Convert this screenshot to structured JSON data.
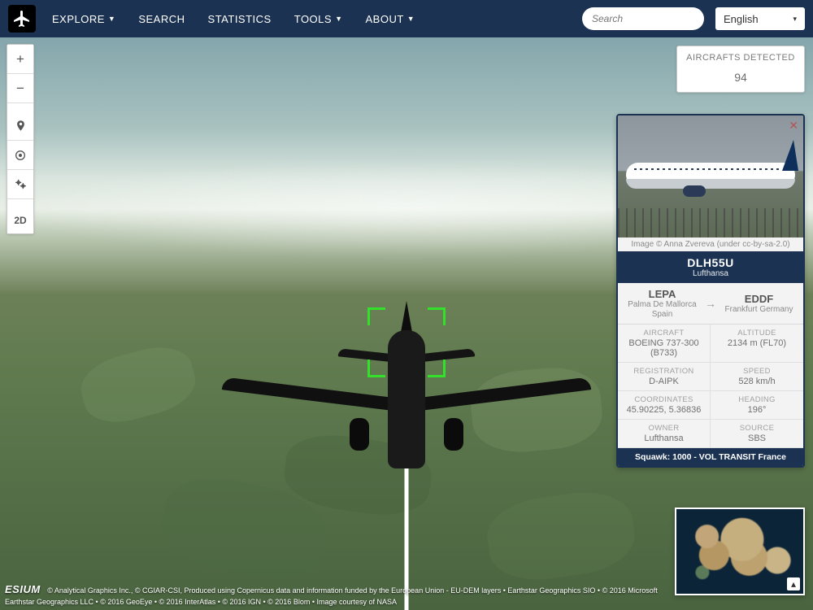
{
  "nav": {
    "items": [
      {
        "label": "EXPLORE",
        "caret": true
      },
      {
        "label": "SEARCH",
        "caret": false
      },
      {
        "label": "STATISTICS",
        "caret": false
      },
      {
        "label": "TOOLS",
        "caret": true
      },
      {
        "label": "ABOUT",
        "caret": true
      }
    ],
    "search_placeholder": "Search",
    "language": "English"
  },
  "toolbar": {
    "zoom_in": "+",
    "zoom_out": "−",
    "mode_label": "2D"
  },
  "detected": {
    "label": "AIRCRAFTS DETECTED",
    "count": "94"
  },
  "flight": {
    "photo_credit": "Image © Anna Zvereva (under cc-by-sa-2.0)",
    "callsign": "DLH55U",
    "airline": "Lufthansa",
    "origin": {
      "code": "LEPA",
      "city": "Palma De Mallorca Spain"
    },
    "destination": {
      "code": "EDDF",
      "city": "Frankfurt Germany"
    },
    "fields": {
      "aircraft_label": "AIRCRAFT",
      "aircraft_value": "BOEING 737-300 (B733)",
      "altitude_label": "ALTITUDE",
      "altitude_value": "2134 m (FL70)",
      "registration_label": "REGISTRATION",
      "registration_value": "D-AIPK",
      "speed_label": "SPEED",
      "speed_value": "528 km/h",
      "coordinates_label": "COORDINATES",
      "coordinates_value": "45.90225, 5.36836",
      "heading_label": "HEADING",
      "heading_value": "196°",
      "owner_label": "OWNER",
      "owner_value": "Lufthansa",
      "source_label": "SOURCE",
      "source_value": "SBS"
    },
    "squawk": "Squawk: 1000 - VOL TRANSIT France"
  },
  "attribution": {
    "brand": "ESIUM",
    "line1": "© Analytical Graphics Inc., © CGIAR-CSI, Produced using Copernicus data and information funded by the European Union - EU-DEM layers • Earthstar Geographics SIO • © 2016 Microsoft",
    "line2": "Earthstar Geographics LLC • © 2016 GeoEye • © 2016 InterAtlas • © 2016 IGN • © 2016 Blom • Image courtesy of NASA"
  }
}
